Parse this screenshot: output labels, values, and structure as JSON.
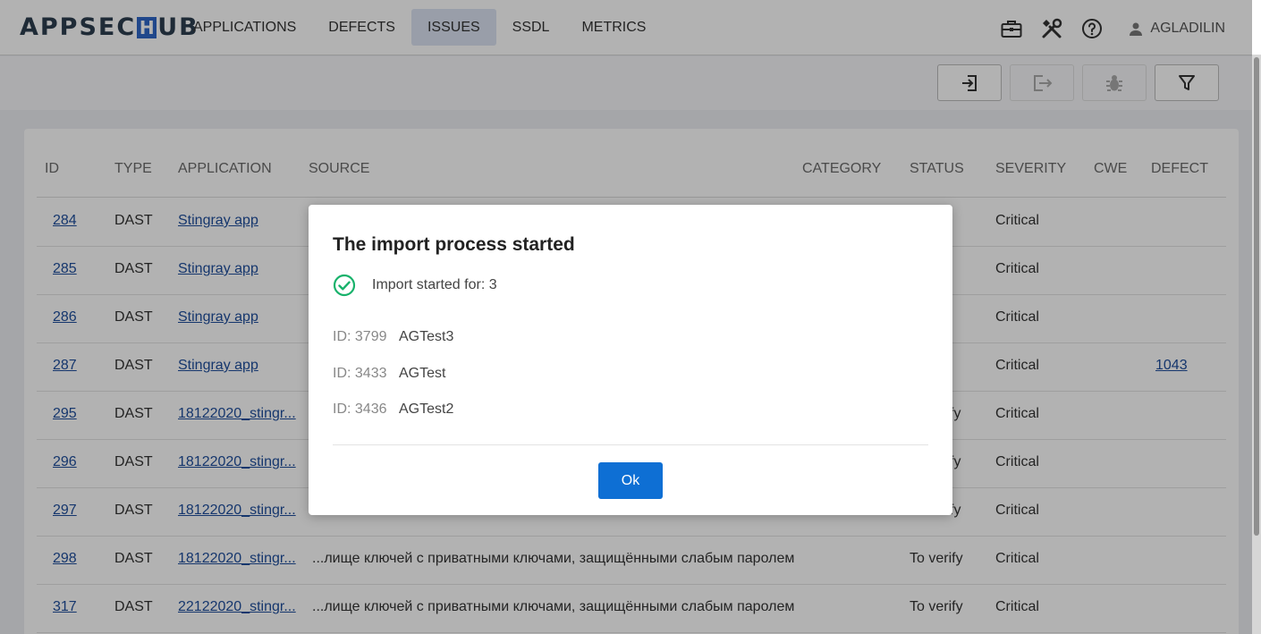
{
  "header": {
    "logo_left": "APPSEC",
    "logo_mark": "H",
    "logo_right": "UB",
    "nav": [
      {
        "label": "APPLICATIONS"
      },
      {
        "label": "DEFECTS"
      },
      {
        "label": "ISSUES"
      },
      {
        "label": "SSDL"
      },
      {
        "label": "METRICS"
      }
    ],
    "active_nav": "ISSUES",
    "icons": [
      "briefcase-icon",
      "tools-icon",
      "help-icon"
    ],
    "user": "AGLADILIN"
  },
  "toolbar": {
    "buttons": [
      {
        "icon": "import-icon",
        "enabled": true
      },
      {
        "icon": "export-icon",
        "enabled": false
      },
      {
        "icon": "bug-icon",
        "enabled": false
      },
      {
        "icon": "filter-icon",
        "enabled": true
      }
    ]
  },
  "table": {
    "columns": [
      "ID",
      "TYPE",
      "APPLICATION",
      "SOURCE",
      "CATEGORY",
      "STATUS",
      "SEVERITY",
      "CWE",
      "DEFECT"
    ],
    "rows": [
      {
        "id": "284",
        "type": "DAST",
        "application": "Stingray app",
        "source": "",
        "status": "",
        "severity": "Critical",
        "defect": ""
      },
      {
        "id": "285",
        "type": "DAST",
        "application": "Stingray app",
        "source": "",
        "status": "",
        "severity": "Critical",
        "defect": ""
      },
      {
        "id": "286",
        "type": "DAST",
        "application": "Stingray app",
        "source": "",
        "status": "",
        "severity": "Critical",
        "defect": ""
      },
      {
        "id": "287",
        "type": "DAST",
        "application": "Stingray app",
        "source": "",
        "status": "",
        "severity": "Critical",
        "defect": "1043"
      },
      {
        "id": "295",
        "type": "DAST",
        "application": "18122020_stingr...",
        "source": "",
        "status": "fy",
        "severity": "Critical",
        "defect": ""
      },
      {
        "id": "296",
        "type": "DAST",
        "application": "18122020_stingr...",
        "source": "",
        "status": "fy",
        "severity": "Critical",
        "defect": ""
      },
      {
        "id": "297",
        "type": "DAST",
        "application": "18122020_stingr...",
        "source": "",
        "status": "fy",
        "severity": "Critical",
        "defect": ""
      },
      {
        "id": "298",
        "type": "DAST",
        "application": "18122020_stingr...",
        "source": "...лище ключей с приватными ключами, защищёнными слабым паролем",
        "status": "To verify",
        "severity": "Critical",
        "defect": ""
      },
      {
        "id": "317",
        "type": "DAST",
        "application": "22122020_stingr...",
        "source": "...лище ключей с приватными ключами, защищёнными слабым паролем",
        "status": "To verify",
        "severity": "Critical",
        "defect": ""
      }
    ]
  },
  "modal": {
    "title": "The import process started",
    "status_text": "Import started for: 3",
    "items": [
      {
        "id": "ID: 3799",
        "name": "AGTest3"
      },
      {
        "id": "ID: 3433",
        "name": "AGTest"
      },
      {
        "id": "ID: 3436",
        "name": "AGTest2"
      }
    ],
    "ok_label": "Ok"
  },
  "colors": {
    "accent": "#0e6fd4",
    "link": "#1f4e9c",
    "success": "#18b26b",
    "logo": "#2d3e50",
    "logo_mark": "#2f66c8"
  }
}
